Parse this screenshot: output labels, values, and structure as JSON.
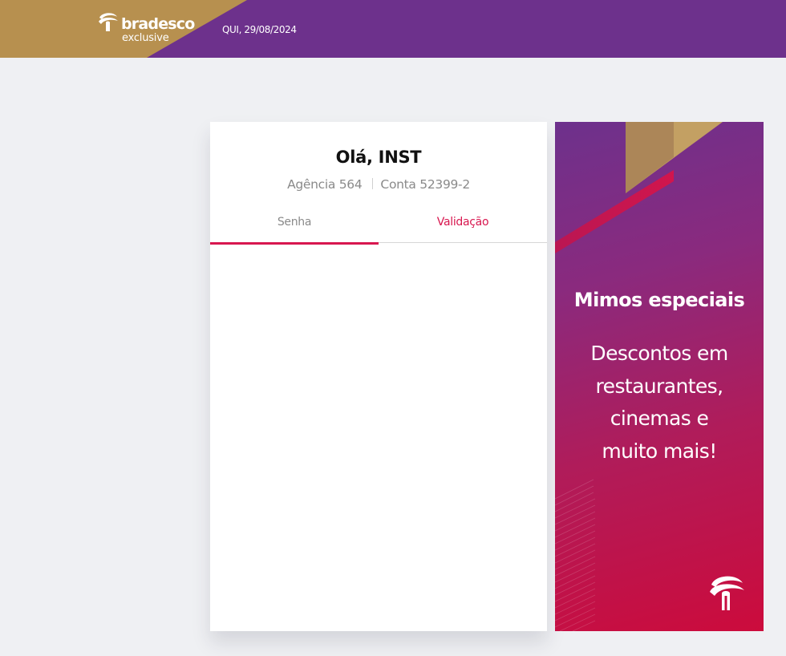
{
  "header": {
    "brand": "bradesco",
    "brand_sub": "exclusive",
    "date": "QUI, 29/08/2024",
    "colors": {
      "purple": "#6d318c",
      "gold": "#b7904f"
    }
  },
  "login": {
    "greeting": "Olá, INST",
    "agency": "Agência 564",
    "account": "Conta 52399-2",
    "tabs": [
      {
        "label": "Senha",
        "active": true
      },
      {
        "label": "Validação",
        "active": false
      }
    ],
    "accent": "#d8174f"
  },
  "promo": {
    "title": "Mimos especiais",
    "lines": [
      "Descontos em",
      "restaurantes,",
      "cinemas e",
      "muito mais!"
    ],
    "logo_icon": "bradesco-tree-icon"
  }
}
